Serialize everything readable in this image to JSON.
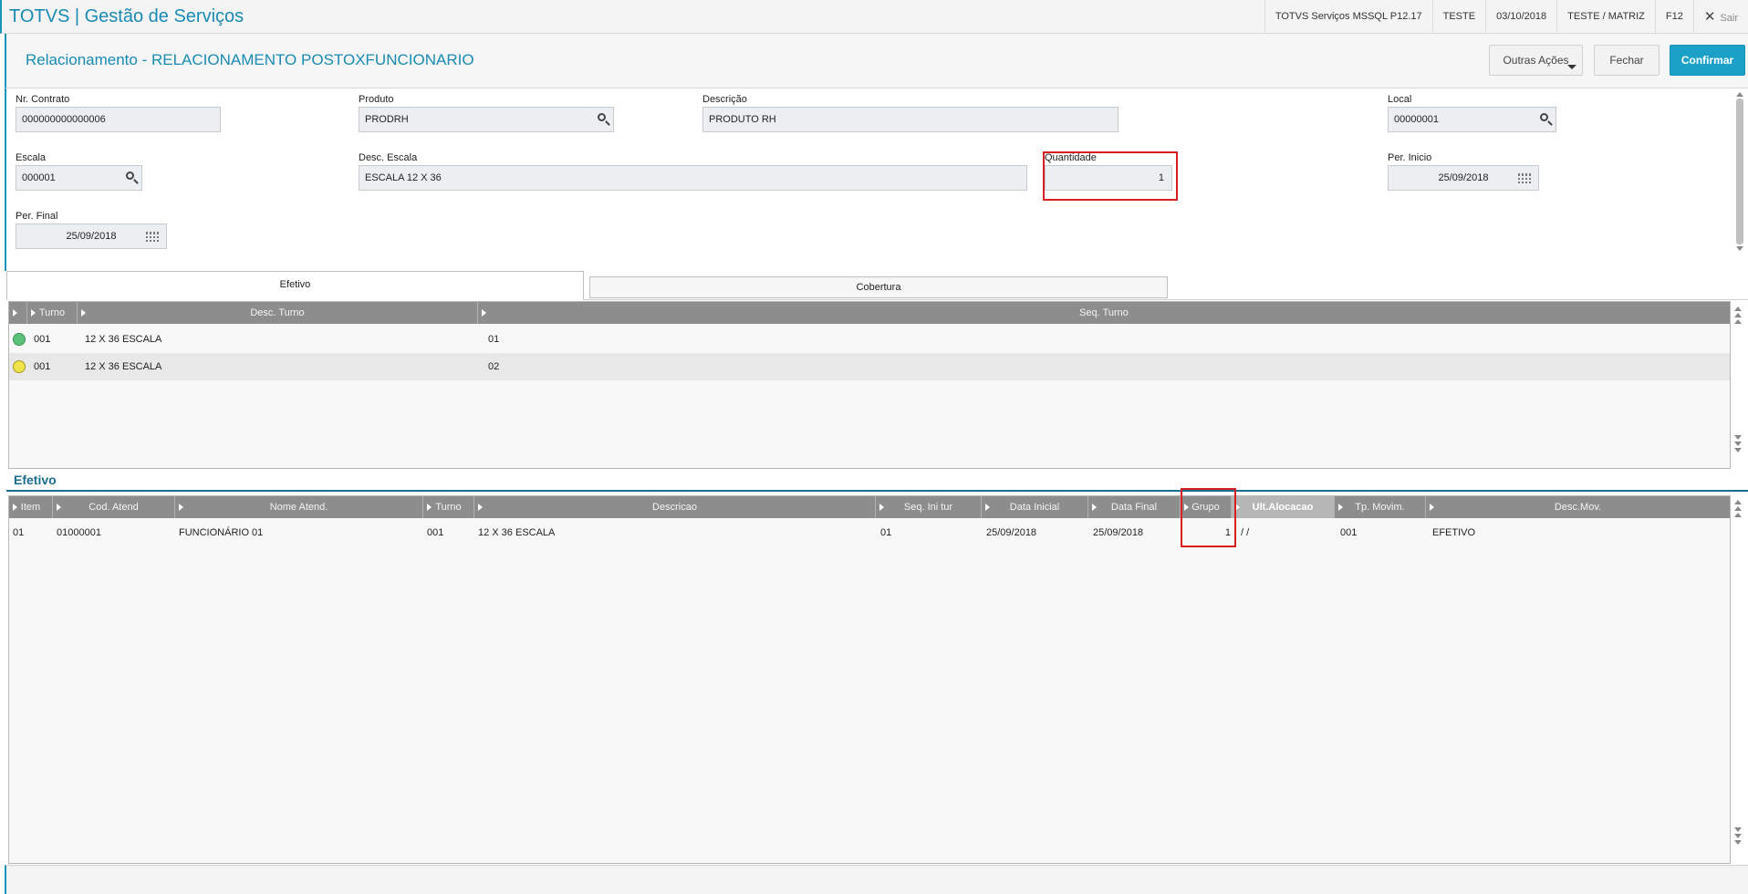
{
  "app": {
    "title": "TOTVS | Gestão de Serviços",
    "env": "TOTVS Serviços MSSQL P12.17",
    "user": "TESTE",
    "date": "03/10/2018",
    "branch": "TESTE / MATRIZ",
    "help": "F12",
    "exit": "Sair"
  },
  "header": {
    "title": "Relacionamento - RELACIONAMENTO POSTOXFUNCIONARIO",
    "outras_acoes": "Outras Ações",
    "fechar": "Fechar",
    "confirmar": "Confirmar"
  },
  "form": {
    "nr_contrato": {
      "label": "Nr. Contrato",
      "value": "000000000000006"
    },
    "produto": {
      "label": "Produto",
      "value": "PRODRH"
    },
    "descricao": {
      "label": "Descrição",
      "value": "PRODUTO RH"
    },
    "local": {
      "label": "Local",
      "value": "00000001"
    },
    "escala": {
      "label": "Escala",
      "value": "000001"
    },
    "desc_escala": {
      "label": "Desc. Escala",
      "value": "ESCALA 12 X 36"
    },
    "quantidade": {
      "label": "Quantidade",
      "value": "1"
    },
    "per_inicio": {
      "label": "Per. Inicio",
      "value": "25/09/2018"
    },
    "per_final": {
      "label": "Per. Final",
      "value": "25/09/2018"
    }
  },
  "tabs": [
    {
      "label": "Efetivo",
      "active": true
    },
    {
      "label": "Cobertura",
      "active": false
    }
  ],
  "turnos_grid": {
    "headers": [
      "Turno",
      "Desc. Turno",
      "Seq. Turno"
    ],
    "rows": [
      {
        "status": "green",
        "turno": "001",
        "desc": "12 X 36  ESCALA",
        "seq": "01"
      },
      {
        "status": "yellow",
        "turno": "001",
        "desc": "12 X 36  ESCALA",
        "seq": "02"
      }
    ]
  },
  "efetivo": {
    "section_title": "Efetivo",
    "headers": [
      "Item",
      "Cod. Atend",
      "Nome Atend.",
      "Turno",
      "Descricao",
      "Seq. Ini tur",
      "Data Inicial",
      "Data Final",
      "Grupo",
      "Ult.Alocacao",
      "Tp. Movim.",
      "Desc.Mov."
    ],
    "rows": [
      {
        "item": "01",
        "cod": "01000001",
        "nome": "FUNCIONÁRIO 01",
        "turno": "001",
        "descricao": "12 X 36  ESCALA",
        "seq": "01",
        "data_ini": "25/09/2018",
        "data_fim": "25/09/2018",
        "grupo": "1",
        "ult_aloc": "/  /",
        "tp_mov": "001",
        "desc_mov": "EFETIVO"
      }
    ]
  },
  "colors": {
    "accent": "#1a8bb3",
    "confirm": "#1ba1c7",
    "highlight": "#d42020",
    "grid_header": "#8d8d8d"
  }
}
